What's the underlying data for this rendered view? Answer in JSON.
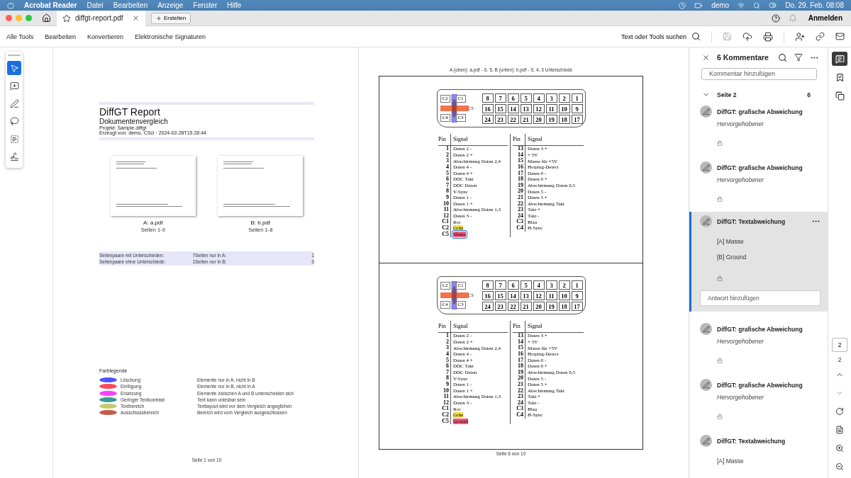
{
  "menubar": {
    "app": "Acrobat Reader",
    "menus": [
      "Datei",
      "Bearbeiten",
      "Anzeige",
      "Fenster",
      "Hilfe"
    ],
    "user": "demo",
    "clock": "Do. 29. Feb.  08:08"
  },
  "tabbar": {
    "tab_title": "diffgt-report.pdf",
    "create": "Erstellen",
    "signin": "Anmelden"
  },
  "toolbar": {
    "items": [
      "Alle Tools",
      "Bearbeiten",
      "Konvertieren",
      "Elektronische Signaturen"
    ],
    "search": "Text oder Tools suchen"
  },
  "tools": [
    {
      "kind": "select",
      "selected": true
    },
    {
      "kind": "comment",
      "selected": false
    },
    {
      "kind": "draw",
      "selected": false
    },
    {
      "kind": "lasso",
      "selected": false
    },
    {
      "kind": "textselect",
      "selected": false
    },
    {
      "kind": "sign",
      "selected": false
    }
  ],
  "page1": {
    "title": "DiffGT Report",
    "subtitle": "Dokumentenvergleich",
    "project": "Projekt: Sample.diffgt",
    "created": "Erzeugt von: demo, CSci · 2024-02-28T15:28:44",
    "thumbnails": [
      {
        "label": "A: a.pdf",
        "pages": "Seiten 1-9"
      },
      {
        "label": "B: b.pdf",
        "pages": "Seiten 1-8"
      }
    ],
    "stats": [
      {
        "label": "Seitenpaare mit Unterschieden:",
        "value": "7"
      },
      {
        "label": "Seiten nur in A:",
        "value": "1"
      },
      {
        "label": "Seitenpaare ohne Unterschiede:",
        "value": "1"
      },
      {
        "label": "Seiten nur in B:",
        "value": "0"
      }
    ],
    "legend_title": "Farblegende",
    "legend": [
      {
        "name": "Löschung",
        "description": "Elemente nur in A, nicht in B",
        "color": "#4a55ff"
      },
      {
        "name": "Einfügung",
        "description": "Elemente nur in B, nicht in A",
        "color": "#ff4a5a"
      },
      {
        "name": "Ersetzung",
        "description": "Elemente zwischen A und B unterscheiden sich",
        "color": "#ff3cff"
      },
      {
        "name": "Geringer Textkontrast",
        "description": "Text kann unlesbar sein",
        "color": "#3a9a98"
      },
      {
        "name": "Textbereich",
        "description": "Textlayout wird vor dem Vergleich angeglichen",
        "color": "#c8c870"
      },
      {
        "name": "Ausschlussbereich",
        "description": "Bereich wird vom Vergleich ausgeschlossen",
        "color": "#c85a48"
      }
    ],
    "footer": "Seite 1 von 10"
  },
  "page2": {
    "caption": "A (oben): a.pdf - S. 5, B (unten): b.pdf - S. 4, 3 Unterschiede",
    "panels": [
      {
        "pin_rows": [
          [
            "8",
            "7",
            "6",
            "5",
            "4",
            "3",
            "2",
            "1"
          ],
          [
            "16",
            "15",
            "14",
            "13",
            "12",
            "11",
            "10",
            "9"
          ],
          [
            "24",
            "23",
            "22",
            "21",
            "20",
            "19",
            "18",
            "17"
          ]
        ],
        "contacts": [
          "C2",
          "C1",
          "C4",
          "C3"
        ],
        "contact_center": "C5",
        "headers": [
          "Pin",
          "Signal",
          "Pin",
          "Signal"
        ],
        "left_rows": [
          {
            "pin": "1",
            "signal": "Daten 2 -",
            "selected": false
          },
          {
            "pin": "2",
            "signal": "Daten 2 +",
            "selected": false
          },
          {
            "pin": "3",
            "signal": "Abschirmung Daten 2,4",
            "selected": false
          },
          {
            "pin": "4",
            "signal": "Daten 4 -",
            "selected": false
          },
          {
            "pin": "5",
            "signal": "Daten 4 +",
            "selected": false
          },
          {
            "pin": "6",
            "signal": "DDC Takt",
            "selected": false
          },
          {
            "pin": "7",
            "signal": "DDC Daten",
            "selected": false
          },
          {
            "pin": "8",
            "signal": "V-Sync",
            "selected": false
          },
          {
            "pin": "9",
            "signal": "Daten 1 -",
            "selected": false
          },
          {
            "pin": "10",
            "signal": "Daten 1 +",
            "selected": false
          },
          {
            "pin": "11",
            "signal": "Abschirmung Daten 1,3",
            "selected": false
          },
          {
            "pin": "12",
            "signal": "Daten 3 -",
            "selected": false
          },
          {
            "pin": "C1",
            "signal": "Rot",
            "selected": false
          },
          {
            "pin": "C2",
            "signal": "Grün",
            "selected": false,
            "color": "#f2e24a"
          },
          {
            "pin": "C5",
            "signal": "Masse",
            "selected": true,
            "color": "#f25a7a"
          }
        ],
        "right_rows": [
          {
            "pin": "13",
            "signal": "Daten 3 +",
            "selected": false
          },
          {
            "pin": "14",
            "signal": "+ 5V",
            "selected": false
          },
          {
            "pin": "15",
            "signal": "Masse für +5V",
            "selected": false
          },
          {
            "pin": "16",
            "signal": "Hotplug-Detect",
            "selected": false
          },
          {
            "pin": "17",
            "signal": "Daten 0 -",
            "selected": false
          },
          {
            "pin": "18",
            "signal": "Daten 0 +",
            "selected": false
          },
          {
            "pin": "19",
            "signal": "Abschirmung Daten 0,5",
            "selected": false
          },
          {
            "pin": "20",
            "signal": "Daten 5 -",
            "selected": false
          },
          {
            "pin": "21",
            "signal": "Daten 5 +",
            "selected": false
          },
          {
            "pin": "22",
            "signal": "Abschirmung Takt",
            "selected": false
          },
          {
            "pin": "23",
            "signal": "Takt +",
            "selected": false
          },
          {
            "pin": "24",
            "signal": "Takt -",
            "selected": false
          },
          {
            "pin": "C3",
            "signal": "Blau",
            "selected": false
          },
          {
            "pin": "C4",
            "signal": "H-Sync",
            "selected": false
          }
        ]
      },
      {
        "pin_rows": [
          [
            "8",
            "7",
            "6",
            "5",
            "4",
            "3",
            "2",
            "1"
          ],
          [
            "16",
            "15",
            "14",
            "13",
            "12",
            "11",
            "10",
            "9"
          ],
          [
            "24",
            "23",
            "22",
            "21",
            "20",
            "19",
            "18",
            "17"
          ]
        ],
        "contacts": [
          "C2",
          "C1",
          "C4",
          "C3"
        ],
        "contact_center": "C5",
        "headers": [
          "Pin",
          "Signal",
          "Pin",
          "Signal"
        ],
        "left_rows": [
          {
            "pin": "1",
            "signal": "Daten 2 -",
            "selected": false
          },
          {
            "pin": "2",
            "signal": "Daten 2 +",
            "selected": false
          },
          {
            "pin": "3",
            "signal": "Abschirmung Daten 2,4",
            "selected": false
          },
          {
            "pin": "4",
            "signal": "Daten 4 -",
            "selected": false
          },
          {
            "pin": "5",
            "signal": "Daten 4 +",
            "selected": false
          },
          {
            "pin": "6",
            "signal": "DDC Takt",
            "selected": false
          },
          {
            "pin": "7",
            "signal": "DDC Daten",
            "selected": false
          },
          {
            "pin": "8",
            "signal": "V-Sync",
            "selected": false
          },
          {
            "pin": "9",
            "signal": "Daten 1 -",
            "selected": false
          },
          {
            "pin": "10",
            "signal": "Daten 1 +",
            "selected": false
          },
          {
            "pin": "11",
            "signal": "Abschirmung Daten 1,3",
            "selected": false
          },
          {
            "pin": "12",
            "signal": "Daten 3 -",
            "selected": false
          },
          {
            "pin": "C1",
            "signal": "Rot",
            "selected": false
          },
          {
            "pin": "C2",
            "signal": "Grün",
            "selected": false,
            "color": "#f2e24a"
          },
          {
            "pin": "C5",
            "signal": "Ground",
            "selected": false,
            "color": "#f25a7a"
          }
        ],
        "right_rows": [
          {
            "pin": "13",
            "signal": "Daten 3 +",
            "selected": false
          },
          {
            "pin": "14",
            "signal": "+ 5V",
            "selected": false
          },
          {
            "pin": "15",
            "signal": "Masse für +5V",
            "selected": false
          },
          {
            "pin": "16",
            "signal": "Hotplug-Detect",
            "selected": false
          },
          {
            "pin": "17",
            "signal": "Daten 0 -",
            "selected": false
          },
          {
            "pin": "18",
            "signal": "Daten 0 +",
            "selected": false
          },
          {
            "pin": "19",
            "signal": "Abschirmung Daten 0,5",
            "selected": false
          },
          {
            "pin": "20",
            "signal": "Daten 5 -",
            "selected": false
          },
          {
            "pin": "21",
            "signal": "Daten 5 +",
            "selected": false
          },
          {
            "pin": "22",
            "signal": "Abschirmung Takt",
            "selected": false
          },
          {
            "pin": "23",
            "signal": "Takt +",
            "selected": false
          },
          {
            "pin": "24",
            "signal": "Takt -",
            "selected": false
          },
          {
            "pin": "C3",
            "signal": "Blau",
            "selected": false
          },
          {
            "pin": "C4",
            "signal": "H-Sync",
            "selected": false
          }
        ]
      }
    ],
    "footer": "Seite 6 von 10"
  },
  "comments": {
    "title": "6 Kommentare",
    "add_placeholder": "Kommentar hinzufügen",
    "group": "Seite 2",
    "group_count": "6",
    "reply_placeholder": "Antwort hinzufügen",
    "items": [
      {
        "kind": "graphic",
        "title": "DiffGT: grafische Abweichung",
        "note": "Hervorgehobener",
        "selected": false
      },
      {
        "kind": "graphic",
        "title": "DiffGT: grafische Abweichung",
        "note": "Hervorgehobener",
        "selected": false
      },
      {
        "kind": "text",
        "title": "DiffGT: Textabweichung",
        "lines": [
          "[A] Masse",
          "[B] Ground"
        ],
        "selected": true
      },
      {
        "kind": "graphic",
        "title": "DiffGT: grafische Abweichung",
        "note": "Hervorgehobener",
        "selected": false
      },
      {
        "kind": "graphic",
        "title": "DiffGT: grafische Abweichung",
        "note": "Hervorgehobener",
        "selected": false
      },
      {
        "kind": "text",
        "title": "DiffGT: Textabweichung",
        "lines": [
          "[A] Masse"
        ],
        "selected": false
      }
    ]
  },
  "rail": {
    "page_value": "2",
    "page_total": "2"
  }
}
